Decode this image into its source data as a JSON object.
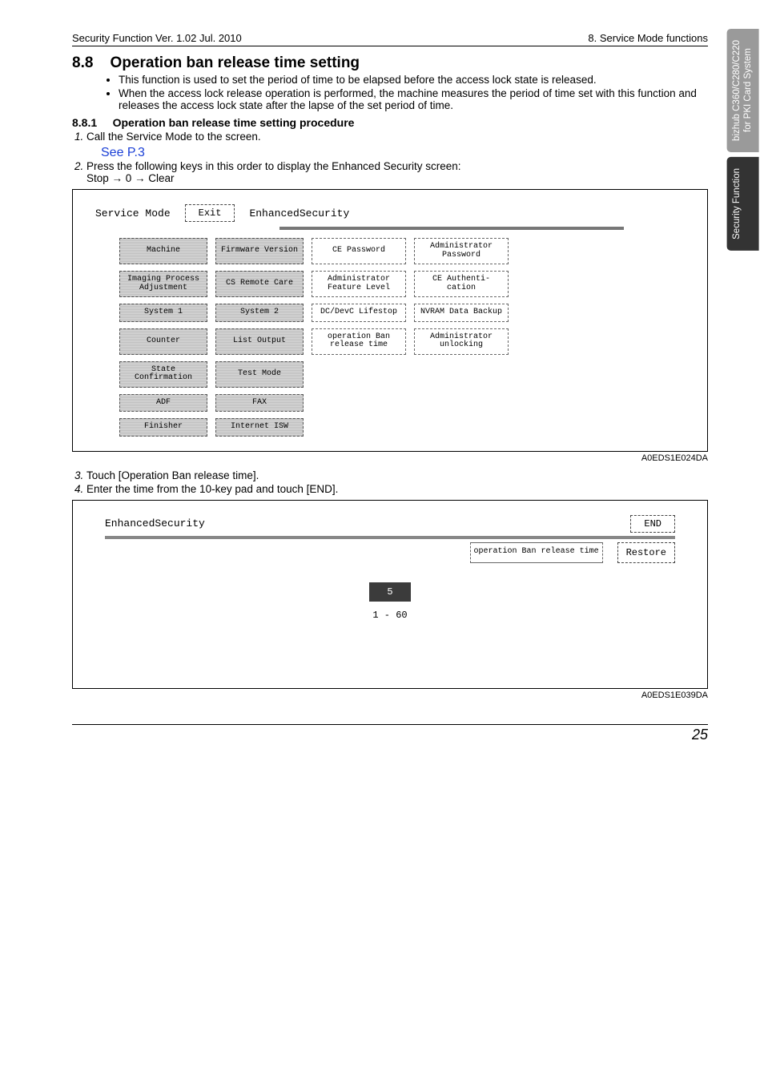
{
  "header_left": "Security Function Ver. 1.02 Jul. 2010",
  "header_right": "8. Service Mode functions",
  "section_num": "8.8",
  "section_title": "Operation ban release time setting",
  "bullets": [
    "This function is used to set the period of time to be elapsed before the access lock state is released.",
    "When the access lock release operation is performed, the machine measures the period of time set with this function and releases the access lock state after the lapse of the set period of time."
  ],
  "sub_num": "8.8.1",
  "sub_title": "Operation ban release time setting procedure",
  "step1": "Call the Service Mode to the screen.",
  "see_link": "See P.3",
  "step2": "Press the following keys in this order to display the Enhanced Security screen:",
  "step2_keys": "Stop → 0 → Clear",
  "step3": "Touch [Operation Ban release time].",
  "step4": "Enter the time from the 10-key pad and touch [END].",
  "fig1": {
    "title_left": "Service Mode",
    "exit_btn": "Exit",
    "title_right": "EnhancedSecurity",
    "grid": [
      [
        "Machine",
        "Firmware Version",
        "CE Password",
        "Administrator Password"
      ],
      [
        "Imaging Process Adjustment",
        "CS Remote Care",
        "Administrator Feature Level",
        "CE Authenti- cation"
      ],
      [
        "System 1",
        "System 2",
        "DC/DevC Lifestop",
        "NVRAM Data Backup"
      ],
      [
        "Counter",
        "List Output",
        "operation Ban release time",
        "Administrator unlocking"
      ],
      [
        "State Confirmation",
        "Test Mode",
        "",
        ""
      ],
      [
        "ADF",
        "FAX",
        "",
        ""
      ],
      [
        "Finisher",
        "Internet ISW",
        "",
        ""
      ]
    ],
    "shaded_cols01": [
      true,
      true,
      false,
      false
    ],
    "code": "A0EDS1E024DA"
  },
  "fig2": {
    "title": "EnhancedSecurity",
    "end_btn": "END",
    "op_label": "operation Ban release time",
    "restore_btn": "Restore",
    "value": "5",
    "range": "1  -  60",
    "code": "A0EDS1E039DA"
  },
  "tabs": {
    "top_line1": "bizhub C360/C280/C220",
    "top_line2": "for PKI Card System",
    "bottom": "Security Function"
  },
  "page_number": "25"
}
